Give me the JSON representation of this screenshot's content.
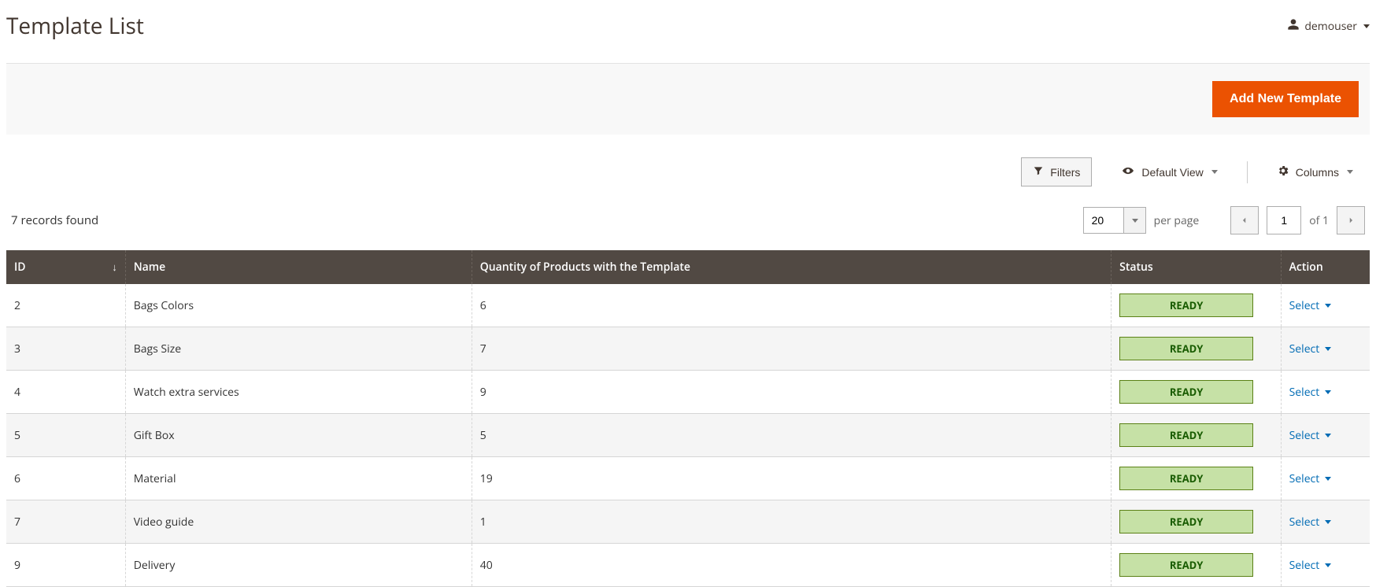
{
  "header": {
    "title": "Template List",
    "user": "demouser"
  },
  "actions": {
    "add_new_template": "Add New Template"
  },
  "toolbar": {
    "filters": "Filters",
    "default_view": "Default View",
    "columns": "Columns"
  },
  "records": {
    "found_text": "7 records found",
    "per_page_value": "20",
    "per_page_label": "per page",
    "current_page": "1",
    "of_text": "of 1"
  },
  "table": {
    "columns": {
      "id": "ID",
      "name": "Name",
      "qty": "Quantity of Products with the Template",
      "status": "Status",
      "action": "Action"
    },
    "action_label": "Select",
    "rows": [
      {
        "id": "2",
        "name": "Bags Colors",
        "qty": "6",
        "status": "READY"
      },
      {
        "id": "3",
        "name": "Bags Size",
        "qty": "7",
        "status": "READY"
      },
      {
        "id": "4",
        "name": "Watch extra services",
        "qty": "9",
        "status": "READY"
      },
      {
        "id": "5",
        "name": "Gift Box",
        "qty": "5",
        "status": "READY"
      },
      {
        "id": "6",
        "name": "Material",
        "qty": "19",
        "status": "READY"
      },
      {
        "id": "7",
        "name": "Video guide",
        "qty": "1",
        "status": "READY"
      },
      {
        "id": "9",
        "name": "Delivery",
        "qty": "40",
        "status": "READY"
      }
    ]
  }
}
